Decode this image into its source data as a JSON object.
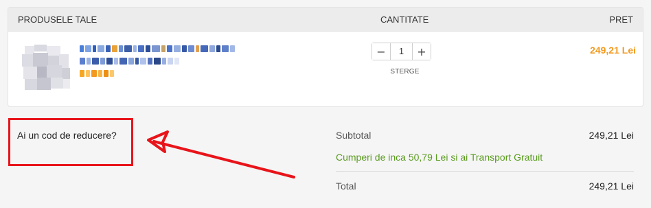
{
  "cart": {
    "header": {
      "products": "PRODUSELE TALE",
      "quantity": "CANTITATE",
      "price": "PRET"
    },
    "item": {
      "quantity": "1",
      "decrement_icon": "minus-icon",
      "increment_icon": "plus-icon",
      "decrement_glyph": "−",
      "increment_glyph": "+",
      "remove_label": "STERGE",
      "price": "249,21 Lei",
      "price_color": "#f39a1e"
    }
  },
  "coupon": {
    "label": "Ai un cod de reducere?",
    "highlight_color": "#e8141a"
  },
  "summary": {
    "subtotal_label": "Subtotal",
    "subtotal_value": "249,21 Lei",
    "free_shipping_message": "Cumperi de inca 50,79 Lei si ai Transport Gratuit",
    "free_shipping_color": "#5a9b1f",
    "total_label": "Total",
    "total_value": "249,21 Lei"
  }
}
